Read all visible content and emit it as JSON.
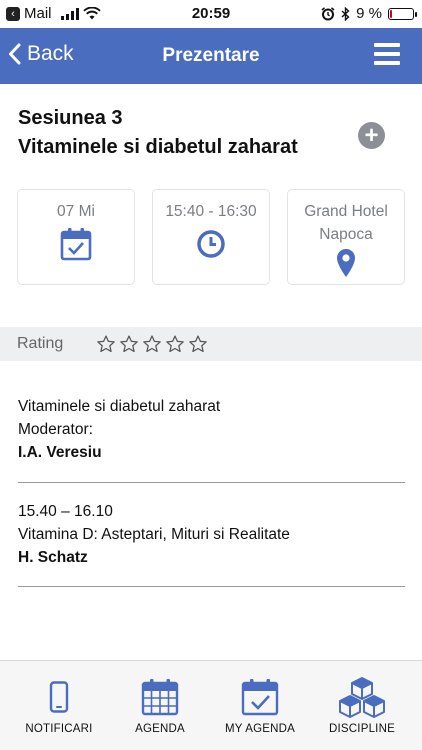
{
  "status_bar": {
    "app": "Mail",
    "time": "20:59",
    "battery": "9 %",
    "battery_level": 0.09
  },
  "nav": {
    "back_label": "Back",
    "title": "Prezentare"
  },
  "session": {
    "title_line1": "Sesiunea 3",
    "title_line2": "Vitaminele si diabetul zaharat"
  },
  "info": {
    "date": "07 Mi",
    "time": "15:40 - 16:30",
    "location_line1": "Grand Hotel",
    "location_line2": "Napoca"
  },
  "rating": {
    "label": "Rating",
    "stars_total": 5,
    "stars_filled": 0
  },
  "content": {
    "intro_title": "Vitaminele si diabetul zaharat",
    "moderator_label": "Moderator:",
    "moderator_name": "I.A. Veresiu",
    "talks": [
      {
        "time": "15.40 – 16.10",
        "title": "Vitamina D: Asteptari, Mituri si Realitate",
        "speaker": "H. Schatz"
      }
    ]
  },
  "tabs": [
    {
      "label": "NOTIFICARI",
      "icon": "phone-icon"
    },
    {
      "label": "AGENDA",
      "icon": "calendar-icon"
    },
    {
      "label": "MY AGENDA",
      "icon": "calendar-check-icon"
    },
    {
      "label": "DISCIPLINE",
      "icon": "cubes-icon"
    }
  ],
  "colors": {
    "primary": "#4a6dbf",
    "icon_grey": "#8c9096",
    "text_grey": "#7a7d82",
    "rating_bg": "#eeeff1"
  }
}
